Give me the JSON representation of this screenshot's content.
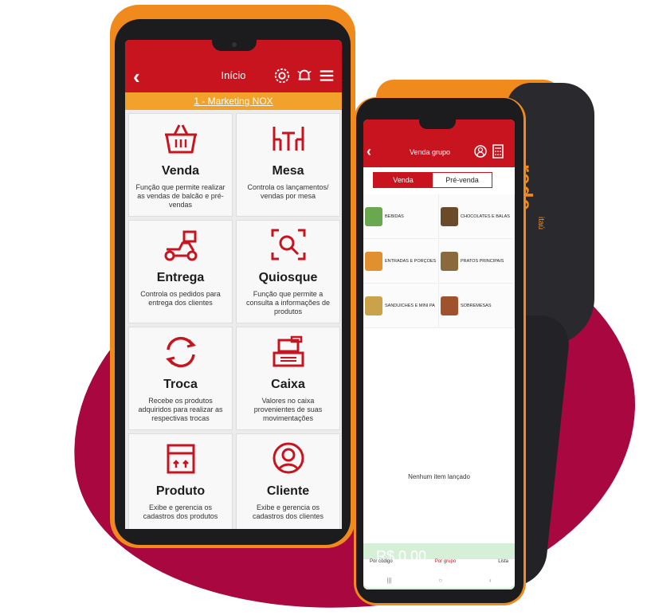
{
  "left_app": {
    "header": {
      "title": "Início"
    },
    "banner": "1 - Marketing NOX",
    "tiles": [
      {
        "name": "Venda",
        "desc": "Função que permite realizar as vendas de balcão e pré-vendas",
        "icon": "basket-icon"
      },
      {
        "name": "Mesa",
        "desc": "Controla os lançamentos/ vendas por mesa",
        "icon": "table-chairs-icon"
      },
      {
        "name": "Entrega",
        "desc": "Controla os pedidos para entrega dos clientes",
        "icon": "delivery-scooter-icon"
      },
      {
        "name": "Quiosque",
        "desc": "Função que permite a consulta a informações de produtos",
        "icon": "scan-search-icon"
      },
      {
        "name": "Troca",
        "desc": "Recebe os produtos adquiridos para realizar as respectivas trocas",
        "icon": "exchange-icon"
      },
      {
        "name": "Caixa",
        "desc": "Valores no caixa provenientes de suas movimentações",
        "icon": "cash-register-icon"
      },
      {
        "name": "Produto",
        "desc": "Exibe e gerencia os cadastros dos produtos",
        "icon": "box-icon"
      },
      {
        "name": "Cliente",
        "desc": "Exibe e gerencia os cadastros dos clientes",
        "icon": "customer-icon"
      }
    ]
  },
  "right_app": {
    "header": {
      "title": "Venda grupo"
    },
    "tabs": [
      {
        "label": "Venda"
      },
      {
        "label": "Pré-venda"
      }
    ],
    "groups": [
      {
        "label": "BEBIDAS",
        "color": "#6aa84f"
      },
      {
        "label": "CHOCOLATES E BALAS",
        "color": "#6b4a2c"
      },
      {
        "label": "ENTRADAS E PORÇÕES",
        "color": "#e0902e"
      },
      {
        "label": "PRATOS PRINCIPAIS",
        "color": "#8a6a3c"
      },
      {
        "label": "SANDUICHES E MINI PA",
        "color": "#c9a24a"
      },
      {
        "label": "SOBREMESAS",
        "color": "#a0522d"
      }
    ],
    "empty_message": "Nenhum item lançado",
    "total": "R$ 0,00",
    "footer": [
      {
        "label": "Por código"
      },
      {
        "label": "Por grupo"
      },
      {
        "label": "Lista"
      }
    ]
  },
  "device_brand": {
    "name": "rede",
    "sub": "itaú"
  },
  "colors": {
    "primary_red": "#c8141e",
    "banner_orange": "#f2a22a",
    "device_orange": "#f08a1c",
    "blob": "#a8073f"
  }
}
